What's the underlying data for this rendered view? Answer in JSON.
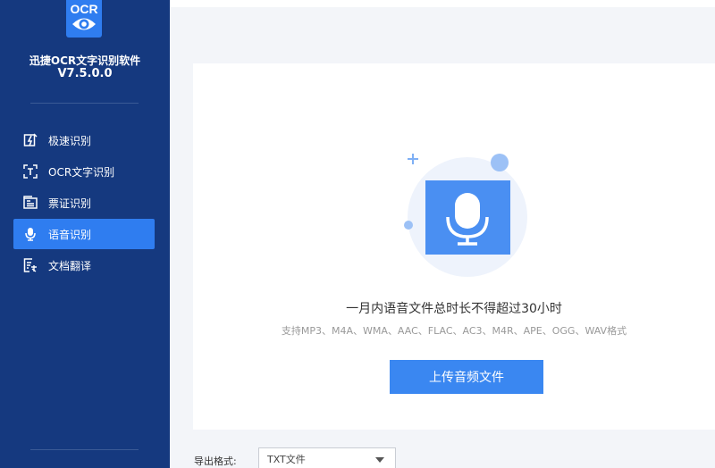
{
  "app": {
    "logo_text": "OCR",
    "name": "迅捷OCR文字识别软件",
    "version": "V7.5.0.0"
  },
  "sidebar": {
    "items": [
      {
        "label": "极速识别",
        "icon": "quick-recognize-icon",
        "active": false
      },
      {
        "label": "OCR文字识别",
        "icon": "text-frame-icon",
        "active": false
      },
      {
        "label": "票证识别",
        "icon": "ticket-icon",
        "active": false
      },
      {
        "label": "语音识别",
        "icon": "microphone-icon",
        "active": true
      },
      {
        "label": "文档翻译",
        "icon": "document-translate-icon",
        "active": false
      }
    ]
  },
  "main": {
    "title": "一月内语音文件总时长不得超过30小时",
    "formats": "支持MP3、M4A、WMA、AAC、FLAC、AC3、M4R、APE、OGG、WAV格式",
    "upload_label": "上传音频文件"
  },
  "export": {
    "label": "导出格式:",
    "selected": "TXT文件"
  },
  "colors": {
    "sidebar_bg": "#15397f",
    "accent": "#2f7df0",
    "button": "#3a87f1"
  }
}
